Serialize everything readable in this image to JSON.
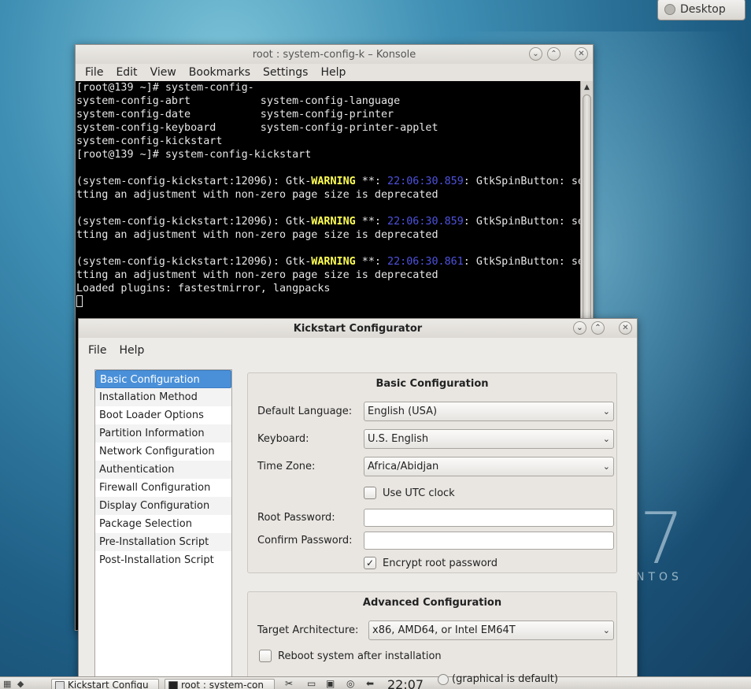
{
  "desktop": {
    "pager_label": "Desktop",
    "brand_number": "7",
    "brand_text": "NTOS"
  },
  "konsole": {
    "title": "root : system-config-k – Konsole",
    "menu": [
      "File",
      "Edit",
      "View",
      "Bookmarks",
      "Settings",
      "Help"
    ],
    "lines": [
      {
        "segments": [
          {
            "t": "[root@139 ~]# system-config-"
          }
        ]
      },
      {
        "segments": [
          {
            "t": "system-config-abrt           system-config-language"
          }
        ]
      },
      {
        "segments": [
          {
            "t": "system-config-date           system-config-printer"
          }
        ]
      },
      {
        "segments": [
          {
            "t": "system-config-keyboard       system-config-printer-applet"
          }
        ]
      },
      {
        "segments": [
          {
            "t": "system-config-kickstart"
          }
        ]
      },
      {
        "segments": [
          {
            "t": "[root@139 ~]# system-config-kickstart"
          }
        ]
      },
      {
        "segments": [
          {
            "t": ""
          }
        ]
      },
      {
        "segments": [
          {
            "t": "(system-config-kickstart:12096): Gtk-"
          },
          {
            "t": "WARNING",
            "c": "warn"
          },
          {
            "t": " **: "
          },
          {
            "t": "22:06:30.859",
            "c": "ts"
          },
          {
            "t": ": GtkSpinButton: se"
          }
        ]
      },
      {
        "segments": [
          {
            "t": "tting an adjustment with non-zero page size is deprecated"
          }
        ]
      },
      {
        "segments": [
          {
            "t": ""
          }
        ]
      },
      {
        "segments": [
          {
            "t": "(system-config-kickstart:12096): Gtk-"
          },
          {
            "t": "WARNING",
            "c": "warn"
          },
          {
            "t": " **: "
          },
          {
            "t": "22:06:30.859",
            "c": "ts"
          },
          {
            "t": ": GtkSpinButton: se"
          }
        ]
      },
      {
        "segments": [
          {
            "t": "tting an adjustment with non-zero page size is deprecated"
          }
        ]
      },
      {
        "segments": [
          {
            "t": ""
          }
        ]
      },
      {
        "segments": [
          {
            "t": "(system-config-kickstart:12096): Gtk-"
          },
          {
            "t": "WARNING",
            "c": "warn"
          },
          {
            "t": " **: "
          },
          {
            "t": "22:06:30.861",
            "c": "ts"
          },
          {
            "t": ": GtkSpinButton: se"
          }
        ]
      },
      {
        "segments": [
          {
            "t": "tting an adjustment with non-zero page size is deprecated"
          }
        ]
      },
      {
        "segments": [
          {
            "t": "Loaded plugins: fastestmirror, langpacks"
          }
        ]
      }
    ]
  },
  "kickstart": {
    "title": "Kickstart Configurator",
    "menu_file": "File",
    "menu_help": "Help",
    "nav": [
      "Basic Configuration",
      "Installation Method",
      "Boot Loader Options",
      "Partition Information",
      "Network Configuration",
      "Authentication",
      "Firewall Configuration",
      "Display Configuration",
      "Package Selection",
      "Pre-Installation Script",
      "Post-Installation Script"
    ],
    "basic": {
      "title": "Basic Configuration",
      "language_label": "Default Language:",
      "language_value": "English (USA)",
      "keyboard_label": "Keyboard:",
      "keyboard_value": "U.S. English",
      "timezone_label": "Time Zone:",
      "timezone_value": "Africa/Abidjan",
      "utc_label": "Use UTC clock",
      "root_pw_label": "Root Password:",
      "confirm_pw_label": "Confirm Password:",
      "encrypt_label": "Encrypt root password"
    },
    "advanced": {
      "title": "Advanced Configuration",
      "arch_label": "Target Architecture:",
      "arch_value": "x86, AMD64, or Intel EM64T",
      "reboot_label": "Reboot system after installation",
      "partial_text": "(graphical is default)"
    }
  },
  "taskbar": {
    "kick_task": "Kickstart Configu",
    "konsole_task": "root : system-con",
    "clock": "22:07"
  }
}
